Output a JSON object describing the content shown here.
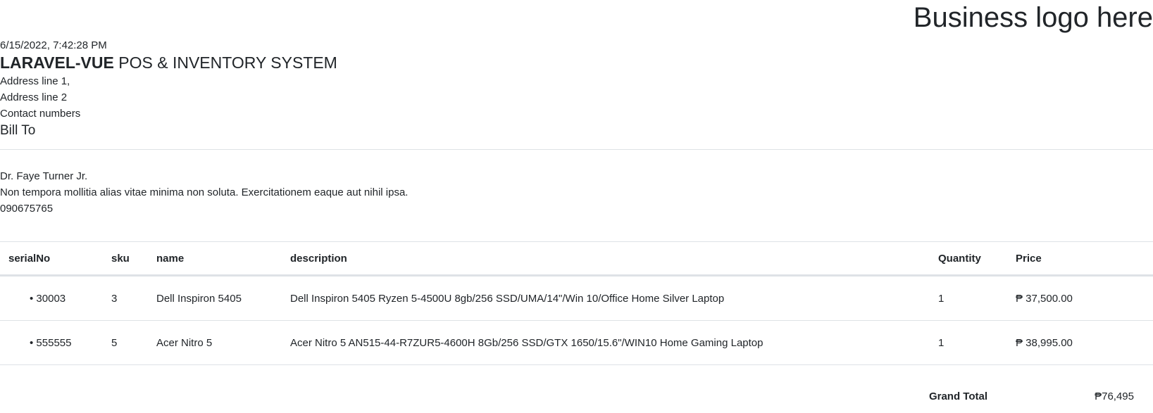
{
  "logo_text": "Business logo here",
  "timestamp": "6/15/2022, 7:42:28 PM",
  "company": {
    "name_bold": "LARAVEL-VUE",
    "name_rest": " POS & INVENTORY SYSTEM",
    "address_line_1": "Address line 1,",
    "address_line_2": "Address line 2",
    "contact": "Contact numbers"
  },
  "bill_to_label": "Bill To",
  "customer": {
    "name": "Dr. Faye Turner Jr.",
    "address": "Non tempora mollitia alias vitae minima non soluta. Exercitationem eaque aut nihil ipsa.",
    "phone": "090675765"
  },
  "table": {
    "headers": [
      "serialNo",
      "sku",
      "name",
      "description",
      "Quantity",
      "Price"
    ],
    "rows": [
      {
        "serial": "• 30003",
        "sku": "3",
        "name": "Dell Inspiron 5405",
        "description": "Dell Inspiron 5405 Ryzen 5-4500U 8gb/256 SSD/UMA/14\"/Win 10/Office Home Silver Laptop",
        "quantity": "1",
        "price": "₱ 37,500.00"
      },
      {
        "serial": "• 555555",
        "sku": "5",
        "name": "Acer Nitro 5",
        "description": "Acer Nitro 5 AN515-44-R7ZUR5-4600H 8Gb/256 SSD/GTX 1650/15.6\"/WIN10 Home Gaming Laptop",
        "quantity": "1",
        "price": "₱ 38,995.00"
      }
    ]
  },
  "grand_total": {
    "label": "Grand Total",
    "value": "₱76,495"
  },
  "colors": {
    "text": "#212529",
    "border": "#dee2e6",
    "background": "#ffffff"
  }
}
